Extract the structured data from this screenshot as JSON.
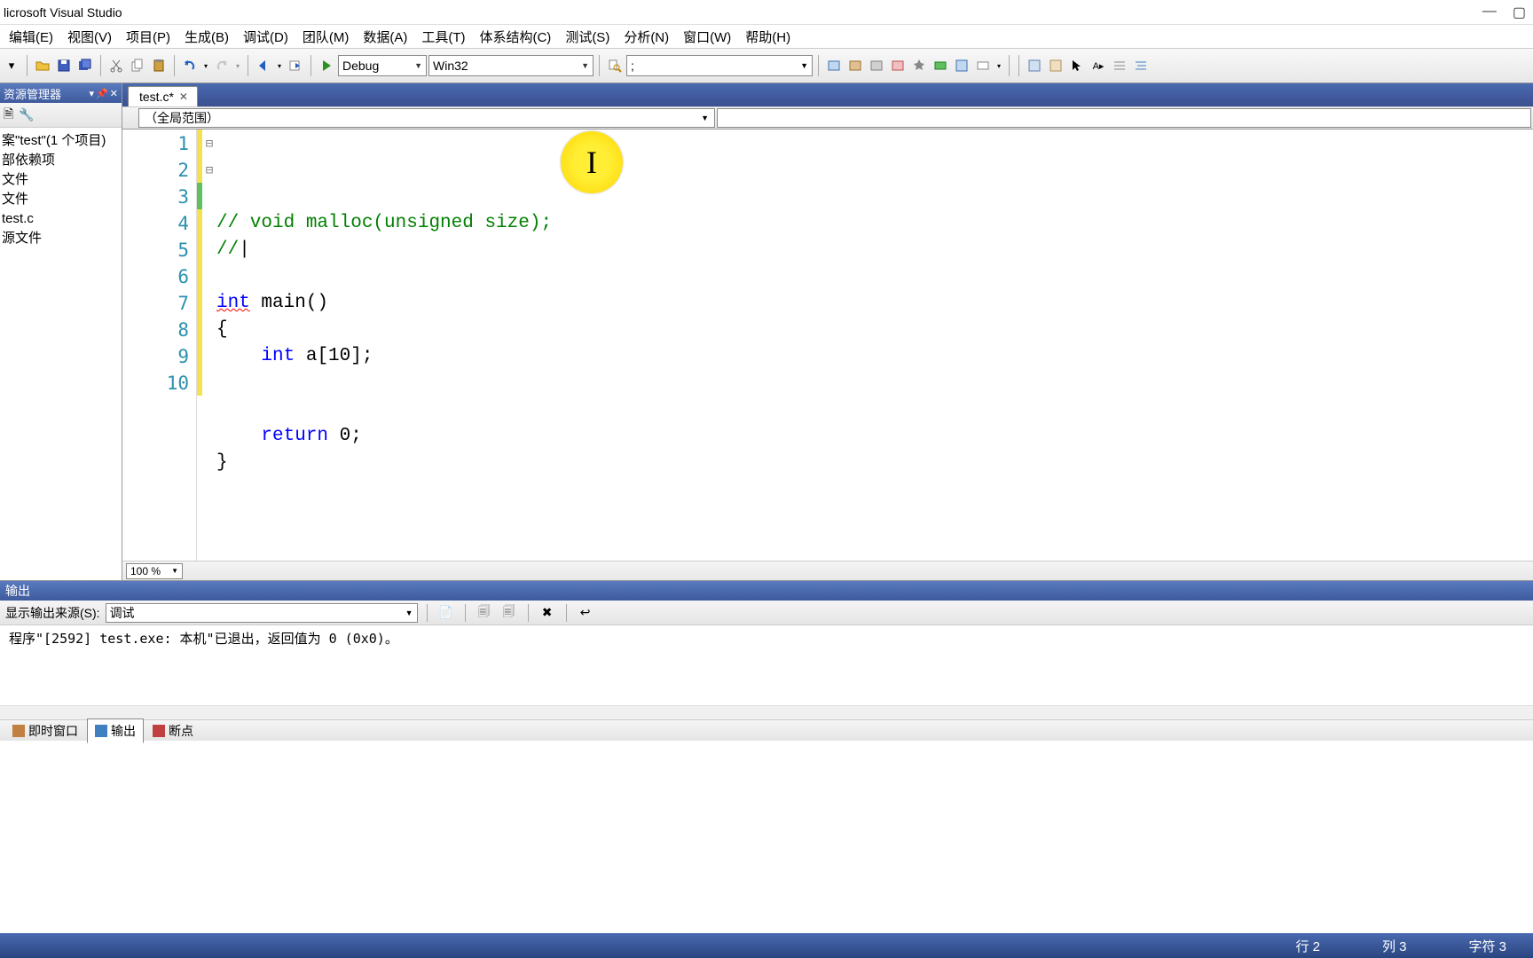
{
  "titlebar": {
    "text": "licrosoft Visual Studio"
  },
  "menubar": [
    "编辑(E)",
    "视图(V)",
    "项目(P)",
    "生成(B)",
    "调试(D)",
    "团队(M)",
    "数据(A)",
    "工具(T)",
    "体系结构(C)",
    "测试(S)",
    "分析(N)",
    "窗口(W)",
    "帮助(H)"
  ],
  "toolbar": {
    "config": "Debug",
    "platform": "Win32",
    "find": ";"
  },
  "sidebar": {
    "title": "资源管理器",
    "tree": [
      "案\"test\"(1 个项目)",
      "部依赖项",
      "文件",
      "文件",
      " test.c",
      "源文件"
    ]
  },
  "editor": {
    "tab": "test.c*",
    "scope": "（全局范围）",
    "lines": [
      {
        "n": "1",
        "change": "yellow",
        "fold": "⊟",
        "seg": [
          {
            "t": "// void malloc(unsigned size);",
            "c": "c-comment"
          }
        ]
      },
      {
        "n": "2",
        "change": "yellow",
        "fold": "",
        "seg": [
          {
            "t": "//",
            "c": "c-comment"
          },
          {
            "t": "|",
            "c": ""
          }
        ]
      },
      {
        "n": "3",
        "change": "green",
        "fold": "",
        "seg": []
      },
      {
        "n": "4",
        "change": "yellow",
        "fold": "⊟",
        "seg": [
          {
            "t": "int",
            "c": "c-keyword c-squiggle"
          },
          {
            "t": " main()",
            "c": ""
          }
        ]
      },
      {
        "n": "5",
        "change": "yellow",
        "fold": "",
        "seg": [
          {
            "t": "{",
            "c": ""
          }
        ]
      },
      {
        "n": "6",
        "change": "yellow",
        "fold": "",
        "seg": [
          {
            "t": "    ",
            "c": ""
          },
          {
            "t": "int",
            "c": "c-keyword"
          },
          {
            "t": " a[10];",
            "c": ""
          }
        ]
      },
      {
        "n": "7",
        "change": "yellow",
        "fold": "",
        "seg": []
      },
      {
        "n": "8",
        "change": "yellow",
        "fold": "",
        "seg": []
      },
      {
        "n": "9",
        "change": "yellow",
        "fold": "",
        "seg": [
          {
            "t": "    ",
            "c": ""
          },
          {
            "t": "return",
            "c": "c-keyword"
          },
          {
            "t": " 0;",
            "c": ""
          }
        ]
      },
      {
        "n": "10",
        "change": "yellow",
        "fold": "",
        "seg": [
          {
            "t": "}",
            "c": ""
          }
        ]
      }
    ],
    "zoom": "100 %"
  },
  "output": {
    "title": "输出",
    "source_label": "显示输出来源(S):",
    "source_value": "调试",
    "text": "程序\"[2592] test.exe: 本机\"已退出，返回值为 0 (0x0)。"
  },
  "bottom_tabs": [
    {
      "label": "即时窗口",
      "active": false
    },
    {
      "label": "输出",
      "active": true
    },
    {
      "label": "断点",
      "active": false
    }
  ],
  "statusbar": {
    "line": "行 2",
    "col": "列 3",
    "char": "字符 3"
  }
}
